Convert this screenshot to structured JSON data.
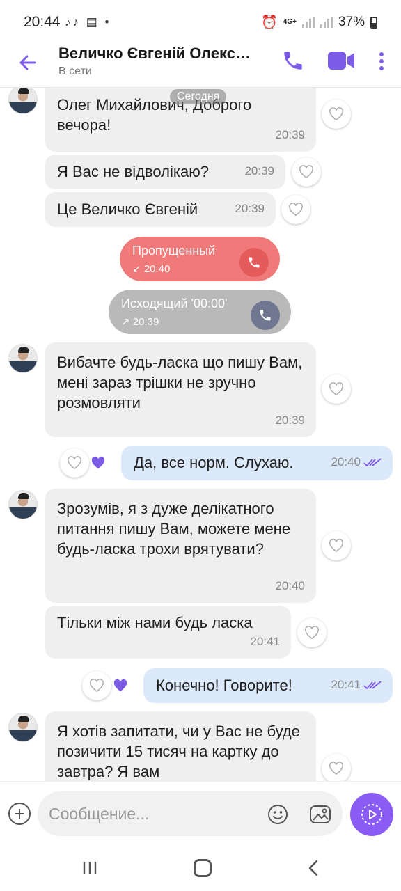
{
  "status_bar": {
    "time": "20:44",
    "network": "4G+",
    "battery": "37%"
  },
  "header": {
    "contact_name": "Величко Євгеній Олекс…",
    "status": "В сети"
  },
  "date_chip": "Сегодня",
  "messages": [
    {
      "text": "Олег Михайлович, Доброго вечора!",
      "time": "20:39"
    },
    {
      "text": "Я Вас не відволікаю?",
      "time": "20:39"
    },
    {
      "text": "Це Величко Євгеній",
      "time": "20:39"
    },
    {
      "text": "Вибачте будь-ласка що пишу Вам, мені зараз трішки не зручно розмовляти",
      "time": "20:39"
    },
    {
      "text": "Да, все норм. Слухаю.",
      "time": "20:40"
    },
    {
      "text": "Зрозумів, я з дуже делікатного питання пишу Вам, можете мене будь-ласка трохи врятувати?",
      "time": "20:40"
    },
    {
      "text": "Тільки між нами будь ласка",
      "time": "20:41"
    },
    {
      "text": "Конечно! Говорите!",
      "time": "20:41"
    },
    {
      "text": "Я хотів запитати, чи у Вас не буде позичити 15 тисяч на картку до завтра? Я вам",
      "time": ""
    }
  ],
  "calls": [
    {
      "label": "Пропущенный",
      "time": "20:40"
    },
    {
      "label": "Исходящий '00:00'",
      "time": "20:39"
    }
  ],
  "composer": {
    "placeholder": "Сообщение..."
  },
  "colors": {
    "accent": "#7c5ce6",
    "missed": "#f07a7a",
    "outgoing_call": "#b9b9b9",
    "outgoing_bubble": "#dbe9fb",
    "incoming_bubble": "#efefef"
  }
}
